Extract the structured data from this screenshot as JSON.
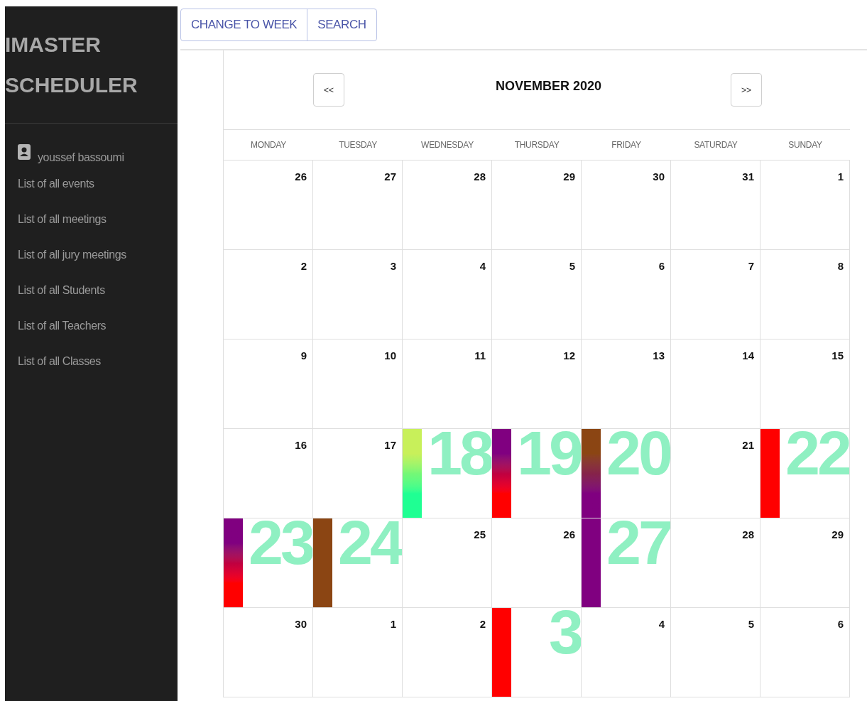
{
  "sidebar": {
    "title": "IMASTER SCHEDULER",
    "user": "youssef bassoumi",
    "items": [
      "List of all events",
      "List of all meetings",
      "List of all jury meetings",
      "List of all Students",
      "List of all Teachers",
      "List of all Classes"
    ]
  },
  "toolbar": {
    "buttons": [
      "CHANGE TO WEEK",
      "SEARCH"
    ]
  },
  "calendar": {
    "title": "NOVEMBER 2020",
    "prev": "<<",
    "next": ">>",
    "weekdays": [
      "MONDAY",
      "TUESDAY",
      "WEDNESDAY",
      "THURSDAY",
      "FRIDAY",
      "SATURDAY",
      "SUNDAY"
    ],
    "weeks": [
      [
        {
          "day": "26"
        },
        {
          "day": "27"
        },
        {
          "day": "28"
        },
        {
          "day": "29"
        },
        {
          "day": "30"
        },
        {
          "day": "31"
        },
        {
          "day": "1"
        }
      ],
      [
        {
          "day": "2"
        },
        {
          "day": "3"
        },
        {
          "day": "4"
        },
        {
          "day": "5"
        },
        {
          "day": "6"
        },
        {
          "day": "7"
        },
        {
          "day": "8"
        }
      ],
      [
        {
          "day": "9"
        },
        {
          "day": "10"
        },
        {
          "day": "11"
        },
        {
          "day": "12"
        },
        {
          "day": "13"
        },
        {
          "day": "14"
        },
        {
          "day": "15"
        }
      ],
      [
        {
          "day": "16"
        },
        {
          "day": "17"
        },
        {
          "day": "18",
          "event": {
            "stops": [
              {
                "color": "#c8f05a"
              },
              {
                "color": "#1fff93"
              }
            ]
          }
        },
        {
          "day": "19",
          "event": {
            "stops": [
              {
                "color": "#800080"
              },
              {
                "color": "#ff0000"
              }
            ]
          }
        },
        {
          "day": "20",
          "event": {
            "stops": [
              {
                "color": "#8b4513"
              },
              {
                "color": "#800080"
              }
            ]
          }
        },
        {
          "day": "21"
        },
        {
          "day": "22",
          "event": {
            "stops": [
              {
                "color": "#ff0000"
              }
            ]
          }
        }
      ],
      [
        {
          "day": "23",
          "event": {
            "stops": [
              {
                "color": "#800080"
              },
              {
                "color": "#ff0000"
              }
            ]
          }
        },
        {
          "day": "24",
          "event": {
            "stops": [
              {
                "color": "#8b4513"
              }
            ]
          }
        },
        {
          "day": "25"
        },
        {
          "day": "26"
        },
        {
          "day": "27",
          "event": {
            "stops": [
              {
                "color": "#800080"
              }
            ]
          }
        },
        {
          "day": "28"
        },
        {
          "day": "29"
        }
      ],
      [
        {
          "day": "30"
        },
        {
          "day": "1"
        },
        {
          "day": "2"
        },
        {
          "day": "3",
          "event": {
            "stops": [
              {
                "color": "#ff0000"
              }
            ]
          }
        },
        {
          "day": "4"
        },
        {
          "day": "5"
        },
        {
          "day": "6"
        }
      ]
    ]
  }
}
